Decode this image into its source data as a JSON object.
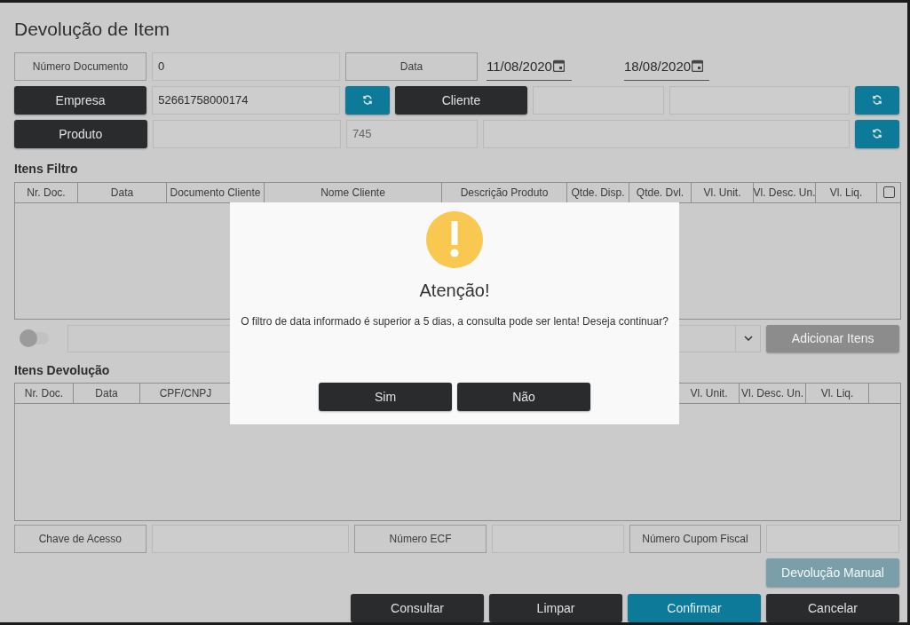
{
  "title": "Devolução de Item",
  "form": {
    "numero_documento": {
      "label": "Número Documento",
      "value": "0"
    },
    "data": {
      "label": "Data",
      "from": "11/08/2020",
      "to": "18/08/2020"
    },
    "empresa": {
      "label": "Empresa",
      "value": "52661758000174"
    },
    "cliente": {
      "label": "Cliente"
    },
    "produto": {
      "label": "Produto",
      "code": "745"
    }
  },
  "filter_section": {
    "title": "Itens Filtro",
    "columns": [
      "Nr. Doc.",
      "Data",
      "Documento Cliente",
      "Nome Cliente",
      "Descrição Produto",
      "Qtde. Disp.",
      "Qtde. Dvl.",
      "Vl. Unit.",
      "Vl. Desc. Un.",
      "Vl. Liq."
    ],
    "select_all_checked": false
  },
  "add_row": {
    "toggle_on": false,
    "add_button": {
      "label": "Adicionar Itens",
      "disabled": true
    }
  },
  "return_section": {
    "title": "Itens Devolução",
    "columns": [
      "Nr. Doc.",
      "Data",
      "CPF/CNPJ",
      "Vl. Unit.",
      "Vl. Desc. Un.",
      "Vl. Liq."
    ]
  },
  "fiscal": [
    {
      "label": "Chave de Acesso"
    },
    {
      "label": "Número ECF"
    },
    {
      "label": "Número Cupom Fiscal"
    }
  ],
  "manual_button": {
    "label": "Devolução Manual",
    "disabled": true
  },
  "actions": [
    {
      "label": "Consultar",
      "kind": "dark"
    },
    {
      "label": "Limpar",
      "kind": "dark"
    },
    {
      "label": "Confirmar",
      "kind": "primary"
    },
    {
      "label": "Cancelar",
      "kind": "dark"
    }
  ],
  "dialog": {
    "title": "Atenção!",
    "message": "O filtro de data informado é superior a 5 dias, a consulta pode ser lenta! Deseja continuar?",
    "buttons": [
      "Sim",
      "Não"
    ]
  }
}
